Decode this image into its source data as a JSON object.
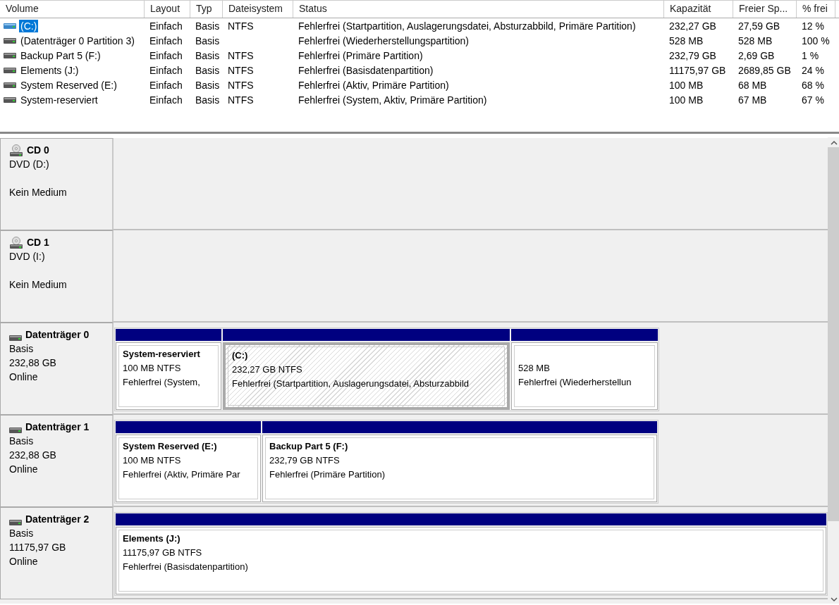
{
  "volume_table": {
    "columns": [
      "Volume",
      "Layout",
      "Typ",
      "Dateisystem",
      "Status",
      "Kapazität",
      "Freier Sp...",
      "% frei"
    ],
    "rows": [
      {
        "selected": true,
        "cells": [
          "(C:)",
          "Einfach",
          "Basis",
          "NTFS",
          "Fehlerfrei (Startpartition, Auslagerungsdatei, Absturzabbild, Primäre Partition)",
          "232,27 GB",
          "27,59 GB",
          "12 %"
        ]
      },
      {
        "selected": false,
        "cells": [
          "(Datenträger 0 Partition 3)",
          "Einfach",
          "Basis",
          "",
          "Fehlerfrei (Wiederherstellungspartition)",
          "528 MB",
          "528 MB",
          "100 %"
        ]
      },
      {
        "selected": false,
        "cells": [
          "Backup Part 5 (F:)",
          "Einfach",
          "Basis",
          "NTFS",
          "Fehlerfrei (Primäre Partition)",
          "232,79 GB",
          "2,69 GB",
          "1 %"
        ]
      },
      {
        "selected": false,
        "cells": [
          "Elements (J:)",
          "Einfach",
          "Basis",
          "NTFS",
          "Fehlerfrei (Basisdatenpartition)",
          "11175,97 GB",
          "2689,85 GB",
          "24 %"
        ]
      },
      {
        "selected": false,
        "cells": [
          "System Reserved (E:)",
          "Einfach",
          "Basis",
          "NTFS",
          "Fehlerfrei (Aktiv, Primäre Partition)",
          "100 MB",
          "68 MB",
          "68 %"
        ]
      },
      {
        "selected": false,
        "cells": [
          "System-reserviert",
          "Einfach",
          "Basis",
          "NTFS",
          "Fehlerfrei (System, Aktiv, Primäre Partition)",
          "100 MB",
          "67 MB",
          "67 %"
        ]
      }
    ]
  },
  "disks": [
    {
      "kind": "cdrom",
      "name": "CD 0",
      "lines": [
        "DVD (D:)",
        "Kein Medium"
      ]
    },
    {
      "kind": "cdrom",
      "name": "CD 1",
      "lines": [
        "DVD (I:)",
        "Kein Medium"
      ]
    },
    {
      "kind": "disk",
      "name": "Datenträger 0",
      "lines": [
        "Basis",
        "232,88 GB",
        "Online"
      ],
      "partitions": [
        {
          "title": "System-reserviert",
          "size": "100 MB NTFS",
          "status": "Fehlerfrei (System,",
          "selected": false
        },
        {
          "title": "(C:)",
          "size": "232,27 GB NTFS",
          "status": "Fehlerfrei (Startpartition, Auslagerungsdatei, Absturzabbild",
          "selected": true
        },
        {
          "size": "528 MB",
          "status": "Fehlerfrei (Wiederherstellun",
          "selected": false
        }
      ]
    },
    {
      "kind": "disk",
      "name": "Datenträger 1",
      "lines": [
        "Basis",
        "232,88 GB",
        "Online"
      ],
      "partitions": [
        {
          "title": "System Reserved  (E:)",
          "size": "100 MB NTFS",
          "status": "Fehlerfrei (Aktiv, Primäre Par",
          "selected": false
        },
        {
          "title": "Backup Part 5  (F:)",
          "size": "232,79 GB NTFS",
          "status": "Fehlerfrei (Primäre Partition)",
          "selected": false
        }
      ]
    },
    {
      "kind": "disk",
      "name": "Datenträger 2",
      "lines": [
        "Basis",
        "11175,97 GB",
        "Online"
      ],
      "partitions": [
        {
          "title": "Elements  (J:)",
          "size": "11175,97 GB NTFS",
          "status": "Fehlerfrei (Basisdatenpartition)",
          "selected": false
        }
      ]
    }
  ]
}
